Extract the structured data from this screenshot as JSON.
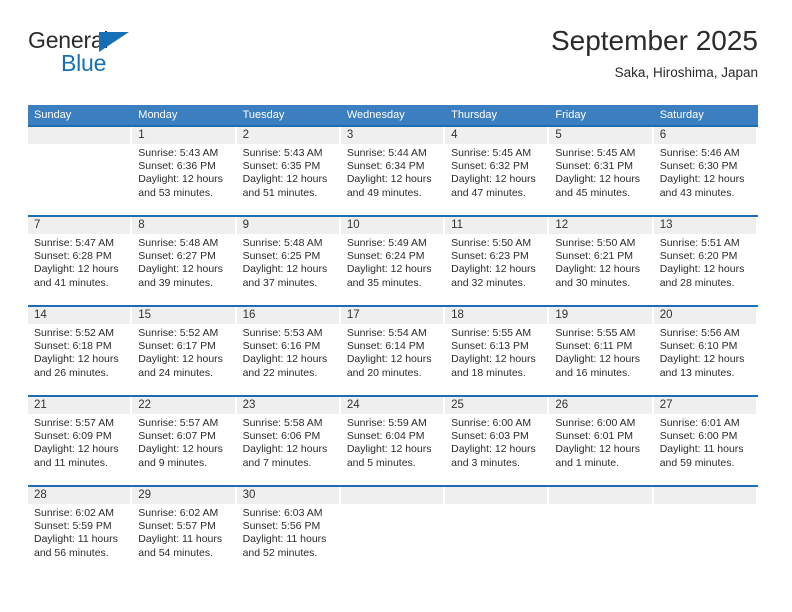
{
  "brand": {
    "name_top": "General",
    "name_bottom": "Blue",
    "accent_color": "#1670b8"
  },
  "header": {
    "title": "September 2025",
    "location": "Saka, Hiroshima, Japan"
  },
  "theme": {
    "header_row_bg": "#3c7fc0",
    "row_border": "#1f6cb0",
    "daynum_band_bg": "#efefef",
    "text": "#2c2c2c"
  },
  "calendar": {
    "weekdays": [
      "Sunday",
      "Monday",
      "Tuesday",
      "Wednesday",
      "Thursday",
      "Friday",
      "Saturday"
    ],
    "weeks": [
      [
        {
          "day": ""
        },
        {
          "day": "1",
          "sunrise": "Sunrise: 5:43 AM",
          "sunset": "Sunset: 6:36 PM",
          "daylight1": "Daylight: 12 hours",
          "daylight2": "and 53 minutes."
        },
        {
          "day": "2",
          "sunrise": "Sunrise: 5:43 AM",
          "sunset": "Sunset: 6:35 PM",
          "daylight1": "Daylight: 12 hours",
          "daylight2": "and 51 minutes."
        },
        {
          "day": "3",
          "sunrise": "Sunrise: 5:44 AM",
          "sunset": "Sunset: 6:34 PM",
          "daylight1": "Daylight: 12 hours",
          "daylight2": "and 49 minutes."
        },
        {
          "day": "4",
          "sunrise": "Sunrise: 5:45 AM",
          "sunset": "Sunset: 6:32 PM",
          "daylight1": "Daylight: 12 hours",
          "daylight2": "and 47 minutes."
        },
        {
          "day": "5",
          "sunrise": "Sunrise: 5:45 AM",
          "sunset": "Sunset: 6:31 PM",
          "daylight1": "Daylight: 12 hours",
          "daylight2": "and 45 minutes."
        },
        {
          "day": "6",
          "sunrise": "Sunrise: 5:46 AM",
          "sunset": "Sunset: 6:30 PM",
          "daylight1": "Daylight: 12 hours",
          "daylight2": "and 43 minutes."
        }
      ],
      [
        {
          "day": "7",
          "sunrise": "Sunrise: 5:47 AM",
          "sunset": "Sunset: 6:28 PM",
          "daylight1": "Daylight: 12 hours",
          "daylight2": "and 41 minutes."
        },
        {
          "day": "8",
          "sunrise": "Sunrise: 5:48 AM",
          "sunset": "Sunset: 6:27 PM",
          "daylight1": "Daylight: 12 hours",
          "daylight2": "and 39 minutes."
        },
        {
          "day": "9",
          "sunrise": "Sunrise: 5:48 AM",
          "sunset": "Sunset: 6:25 PM",
          "daylight1": "Daylight: 12 hours",
          "daylight2": "and 37 minutes."
        },
        {
          "day": "10",
          "sunrise": "Sunrise: 5:49 AM",
          "sunset": "Sunset: 6:24 PM",
          "daylight1": "Daylight: 12 hours",
          "daylight2": "and 35 minutes."
        },
        {
          "day": "11",
          "sunrise": "Sunrise: 5:50 AM",
          "sunset": "Sunset: 6:23 PM",
          "daylight1": "Daylight: 12 hours",
          "daylight2": "and 32 minutes."
        },
        {
          "day": "12",
          "sunrise": "Sunrise: 5:50 AM",
          "sunset": "Sunset: 6:21 PM",
          "daylight1": "Daylight: 12 hours",
          "daylight2": "and 30 minutes."
        },
        {
          "day": "13",
          "sunrise": "Sunrise: 5:51 AM",
          "sunset": "Sunset: 6:20 PM",
          "daylight1": "Daylight: 12 hours",
          "daylight2": "and 28 minutes."
        }
      ],
      [
        {
          "day": "14",
          "sunrise": "Sunrise: 5:52 AM",
          "sunset": "Sunset: 6:18 PM",
          "daylight1": "Daylight: 12 hours",
          "daylight2": "and 26 minutes."
        },
        {
          "day": "15",
          "sunrise": "Sunrise: 5:52 AM",
          "sunset": "Sunset: 6:17 PM",
          "daylight1": "Daylight: 12 hours",
          "daylight2": "and 24 minutes."
        },
        {
          "day": "16",
          "sunrise": "Sunrise: 5:53 AM",
          "sunset": "Sunset: 6:16 PM",
          "daylight1": "Daylight: 12 hours",
          "daylight2": "and 22 minutes."
        },
        {
          "day": "17",
          "sunrise": "Sunrise: 5:54 AM",
          "sunset": "Sunset: 6:14 PM",
          "daylight1": "Daylight: 12 hours",
          "daylight2": "and 20 minutes."
        },
        {
          "day": "18",
          "sunrise": "Sunrise: 5:55 AM",
          "sunset": "Sunset: 6:13 PM",
          "daylight1": "Daylight: 12 hours",
          "daylight2": "and 18 minutes."
        },
        {
          "day": "19",
          "sunrise": "Sunrise: 5:55 AM",
          "sunset": "Sunset: 6:11 PM",
          "daylight1": "Daylight: 12 hours",
          "daylight2": "and 16 minutes."
        },
        {
          "day": "20",
          "sunrise": "Sunrise: 5:56 AM",
          "sunset": "Sunset: 6:10 PM",
          "daylight1": "Daylight: 12 hours",
          "daylight2": "and 13 minutes."
        }
      ],
      [
        {
          "day": "21",
          "sunrise": "Sunrise: 5:57 AM",
          "sunset": "Sunset: 6:09 PM",
          "daylight1": "Daylight: 12 hours",
          "daylight2": "and 11 minutes."
        },
        {
          "day": "22",
          "sunrise": "Sunrise: 5:57 AM",
          "sunset": "Sunset: 6:07 PM",
          "daylight1": "Daylight: 12 hours",
          "daylight2": "and 9 minutes."
        },
        {
          "day": "23",
          "sunrise": "Sunrise: 5:58 AM",
          "sunset": "Sunset: 6:06 PM",
          "daylight1": "Daylight: 12 hours",
          "daylight2": "and 7 minutes."
        },
        {
          "day": "24",
          "sunrise": "Sunrise: 5:59 AM",
          "sunset": "Sunset: 6:04 PM",
          "daylight1": "Daylight: 12 hours",
          "daylight2": "and 5 minutes."
        },
        {
          "day": "25",
          "sunrise": "Sunrise: 6:00 AM",
          "sunset": "Sunset: 6:03 PM",
          "daylight1": "Daylight: 12 hours",
          "daylight2": "and 3 minutes."
        },
        {
          "day": "26",
          "sunrise": "Sunrise: 6:00 AM",
          "sunset": "Sunset: 6:01 PM",
          "daylight1": "Daylight: 12 hours",
          "daylight2": "and 1 minute."
        },
        {
          "day": "27",
          "sunrise": "Sunrise: 6:01 AM",
          "sunset": "Sunset: 6:00 PM",
          "daylight1": "Daylight: 11 hours",
          "daylight2": "and 59 minutes."
        }
      ],
      [
        {
          "day": "28",
          "sunrise": "Sunrise: 6:02 AM",
          "sunset": "Sunset: 5:59 PM",
          "daylight1": "Daylight: 11 hours",
          "daylight2": "and 56 minutes."
        },
        {
          "day": "29",
          "sunrise": "Sunrise: 6:02 AM",
          "sunset": "Sunset: 5:57 PM",
          "daylight1": "Daylight: 11 hours",
          "daylight2": "and 54 minutes."
        },
        {
          "day": "30",
          "sunrise": "Sunrise: 6:03 AM",
          "sunset": "Sunset: 5:56 PM",
          "daylight1": "Daylight: 11 hours",
          "daylight2": "and 52 minutes."
        },
        {
          "day": ""
        },
        {
          "day": ""
        },
        {
          "day": ""
        },
        {
          "day": ""
        }
      ]
    ]
  }
}
